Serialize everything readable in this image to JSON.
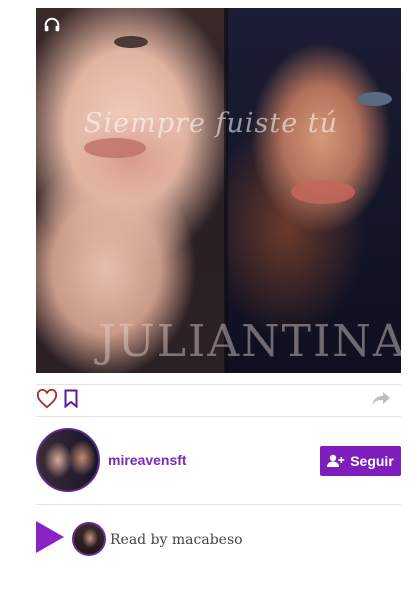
{
  "cover": {
    "script_title": "Siempre fuiste tú",
    "caps_title": "JULIANTINA",
    "audio_icon": "headphones-icon"
  },
  "actions": {
    "like_icon": "heart-outline-icon",
    "save_icon": "bookmark-outline-icon",
    "share_icon": "share-arrow-icon"
  },
  "author": {
    "username": "mireavensft",
    "follow_label": "Seguir",
    "follow_icon": "user-plus-icon"
  },
  "reader": {
    "label": "Read by macabeso",
    "play_icon": "play-icon"
  },
  "colors": {
    "accent": "#7e1fbd",
    "username": "#7b2cb0",
    "heart": "#a0302a",
    "bookmark": "#5b1b9a",
    "share": "#bdbdbd"
  }
}
